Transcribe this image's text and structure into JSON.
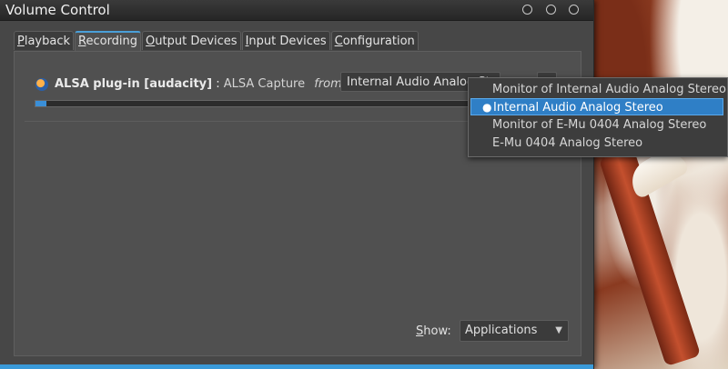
{
  "window": {
    "title": "Volume Control"
  },
  "tabs": [
    {
      "pre": "",
      "u": "P",
      "post": "layback"
    },
    {
      "pre": "",
      "u": "R",
      "post": "ecording"
    },
    {
      "pre": "",
      "u": "O",
      "post": "utput Devices"
    },
    {
      "pre": "",
      "u": "I",
      "post": "nput Devices"
    },
    {
      "pre": "",
      "u": "C",
      "post": "onfiguration"
    }
  ],
  "active_tab": "Recording",
  "stream": {
    "name": "ALSA plug-in [audacity]",
    "separator": ":",
    "subtitle": "ALSA Capture",
    "from_label": "from",
    "selected_device": "Internal Audio Analog Stereo",
    "level_fraction": 0.005
  },
  "device_menu": {
    "items": [
      "Monitor of Internal Audio Analog Stereo",
      "Internal Audio Analog Stereo",
      "Monitor of E-Mu 0404 Analog Stereo",
      "E-Mu 0404 Analog Stereo"
    ],
    "selected_index": 1
  },
  "footer": {
    "show_label_u": "S",
    "show_label_rest": "how:",
    "show_value": "Applications"
  },
  "colors": {
    "accent": "#3a9ad9",
    "selection": "#2f7fc6"
  }
}
